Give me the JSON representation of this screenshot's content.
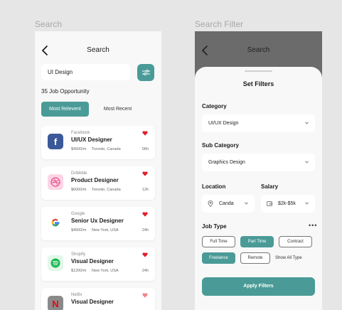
{
  "boards": {
    "left_label": "Search",
    "right_label": "Search Filter"
  },
  "search_screen": {
    "title": "Search",
    "search_value": "UI Design",
    "result_count": "35 Job Opportunity",
    "tabs": [
      {
        "label": "Most Relevent",
        "active": true
      },
      {
        "label": "Most Recent",
        "active": false
      }
    ],
    "jobs": [
      {
        "company": "Facebook",
        "title": "UI/UX Designer",
        "salary": "$4500/m",
        "location": "Toronto, Canada",
        "age": "06h",
        "logo_icon": "facebook-icon"
      },
      {
        "company": "Dribbble",
        "title": "Product Designer",
        "salary": "$6000/m",
        "location": "Toronto, Canada",
        "age": "12h",
        "logo_icon": "dribbble-icon"
      },
      {
        "company": "Google",
        "title": "Senior Ux Designer",
        "salary": "$4500/m",
        "location": "New York, USA",
        "age": "24h",
        "logo_icon": "google-icon"
      },
      {
        "company": "Shopify",
        "title": "Visual Designer",
        "salary": "$1200/m",
        "location": "New York, USA",
        "age": "24h",
        "logo_icon": "spotify-icon"
      },
      {
        "company": "Netfix",
        "title": "Visual Designer",
        "salary": "",
        "location": "",
        "age": "",
        "logo_icon": "netflix-icon"
      }
    ]
  },
  "filter_screen": {
    "title": "Search",
    "sheet_title": "Set Filters",
    "category": {
      "label": "Category",
      "value": "UI/UX Design"
    },
    "sub_category": {
      "label": "Sub Category",
      "value": "Graphics Design"
    },
    "location": {
      "label": "Location",
      "value": "Canda"
    },
    "salary": {
      "label": "Salary",
      "value": "$2k-$5k"
    },
    "job_type": {
      "label": "Job Type",
      "chips": [
        {
          "label": "Full Time",
          "active": false
        },
        {
          "label": "Part Time",
          "active": true
        },
        {
          "label": "Contract",
          "active": false
        },
        {
          "label": "Freelance",
          "active": true
        },
        {
          "label": "Remote",
          "active": false
        }
      ],
      "show_all": "Show All Type"
    },
    "apply_label": "Apply Filters"
  },
  "colors": {
    "accent": "#4a9b97",
    "heart": "#e0202c",
    "facebook": "#3b5998",
    "dribbble_bg": "#fbd5e3",
    "spotify": "#1db954"
  }
}
